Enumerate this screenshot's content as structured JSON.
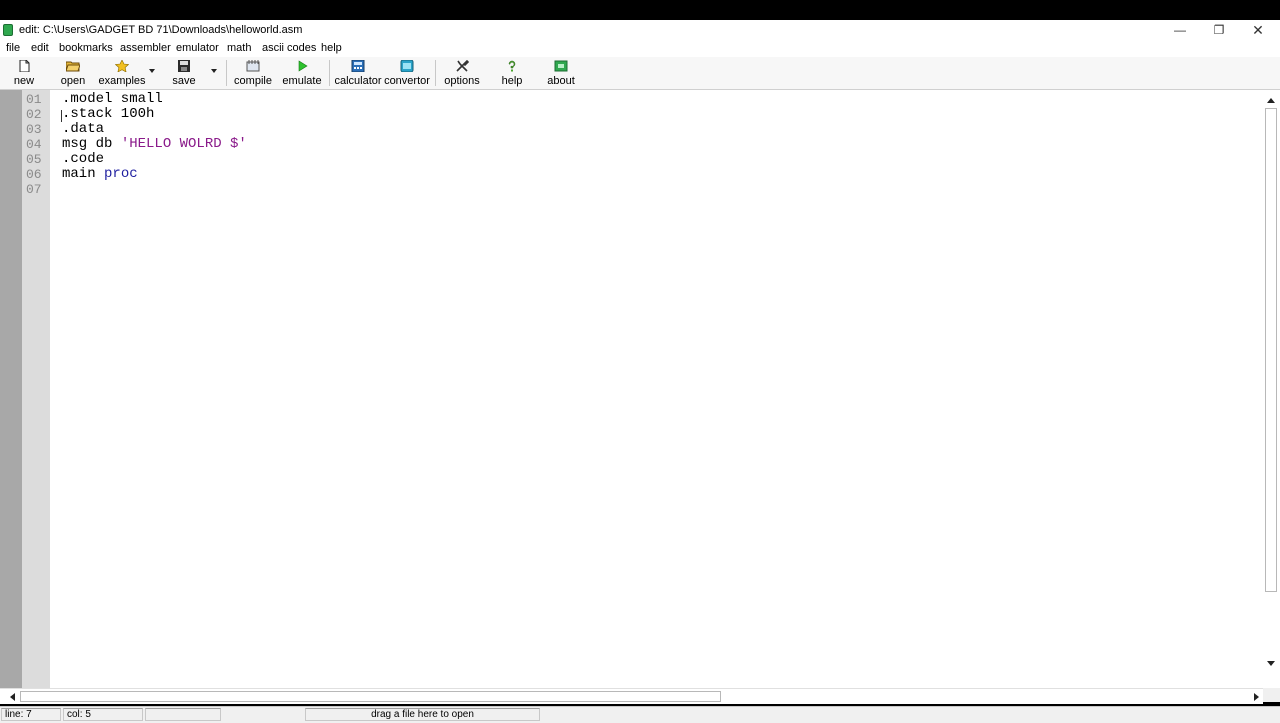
{
  "window": {
    "title": "edit: C:\\Users\\GADGET BD 71\\Downloads\\helloworld.asm",
    "controls": {
      "minimize": "—",
      "maximize": "❐",
      "close": "✕"
    }
  },
  "menu": [
    "file",
    "edit",
    "bookmarks",
    "assembler",
    "emulator",
    "math",
    "ascii codes",
    "help"
  ],
  "toolbar": {
    "new": "new",
    "open": "open",
    "examples": "examples",
    "save": "save",
    "compile": "compile",
    "emulate": "emulate",
    "calculator": "calculator",
    "convertor": "convertor",
    "options": "options",
    "help": "help",
    "about": "about"
  },
  "editor": {
    "line_numbers": [
      "01",
      "02",
      "03",
      "04",
      "05",
      "06",
      "07"
    ],
    "lines": [
      {
        "text": ".model small"
      },
      {
        "text": ".stack 100h"
      },
      {
        "text": ".data"
      },
      {
        "prefix": "msg db ",
        "string": "'HELLO WOLRD $'"
      },
      {
        "text": ".code"
      },
      {
        "prefix": "main ",
        "keyword": "proc"
      },
      {
        "text": ""
      }
    ]
  },
  "status": {
    "line": "line: 7",
    "col": "col: 5",
    "hint": "drag a file here to open"
  },
  "colors": {
    "keyword": "#1f1fa0",
    "string": "#8a1a8a",
    "gutter": "#dcdcdc"
  }
}
